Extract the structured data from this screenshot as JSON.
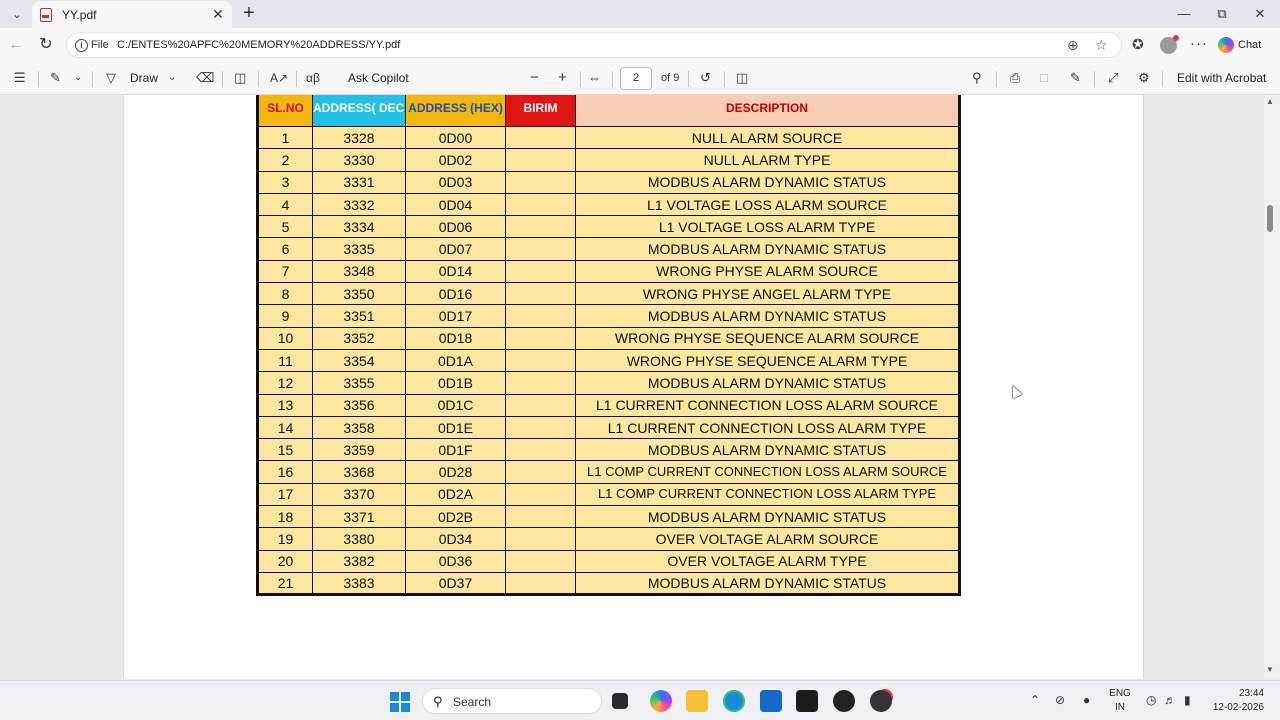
{
  "browser": {
    "tab_title": "YY.pdf",
    "url_scheme": "File",
    "url": "C:/ENTES%20APFC%20MEMORY%20ADDRESS/YY.pdf",
    "chat_label": "Chat",
    "accent_color": "#c4302b"
  },
  "pdf_toolbar": {
    "draw_label": "Draw",
    "ask_copilot_label": "Ask Copilot",
    "page_current": "2",
    "page_total": "of 9",
    "edit_acrobat_label": "Edit with Acrobat"
  },
  "table": {
    "headers": [
      "SL.NO",
      "ADDRESS( DEC)",
      "ADDRESS (HEX)",
      "BIRIM",
      "DESCRIPTION"
    ],
    "rows": [
      [
        "1",
        "3328",
        "0D00",
        "",
        "NULL ALARM SOURCE"
      ],
      [
        "2",
        "3330",
        "0D02",
        "",
        "NULL ALARM TYPE"
      ],
      [
        "3",
        "3331",
        "0D03",
        "",
        "MODBUS ALARM DYNAMIC STATUS"
      ],
      [
        "4",
        "3332",
        "0D04",
        "",
        "L1 VOLTAGE LOSS ALARM SOURCE"
      ],
      [
        "5",
        "3334",
        "0D06",
        "",
        "L1 VOLTAGE LOSS ALARM TYPE"
      ],
      [
        "6",
        "3335",
        "0D07",
        "",
        "MODBUS ALARM DYNAMIC STATUS"
      ],
      [
        "7",
        "3348",
        "0D14",
        "",
        "WRONG PHYSE ALARM SOURCE"
      ],
      [
        "8",
        "3350",
        "0D16",
        "",
        "WRONG PHYSE ANGEL ALARM TYPE"
      ],
      [
        "9",
        "3351",
        "0D17",
        "",
        "MODBUS ALARM DYNAMIC STATUS"
      ],
      [
        "10",
        "3352",
        "0D18",
        "",
        "WRONG PHYSE  SEQUENCE ALARM SOURCE"
      ],
      [
        "11",
        "3354",
        "0D1A",
        "",
        "WRONG PHYSE  SEQUENCE ALARM TYPE"
      ],
      [
        "12",
        "3355",
        "0D1B",
        "",
        "MODBUS ALARM DYNAMIC STATUS"
      ],
      [
        "13",
        "3356",
        "0D1C",
        "",
        "L1 CURRENT CONNECTION LOSS ALARM SOURCE"
      ],
      [
        "14",
        "3358",
        "0D1E",
        "",
        "L1 CURRENT CONNECTION LOSS ALARM TYPE"
      ],
      [
        "15",
        "3359",
        "0D1F",
        "",
        "MODBUS ALARM DYNAMIC STATUS"
      ],
      [
        "16",
        "3368",
        "0D28",
        "",
        "L1 COMP CURRENT CONNECTION LOSS ALARM SOURCE"
      ],
      [
        "17",
        "3370",
        "0D2A",
        "",
        "L1 COMP CURRENT CONNECTION LOSS ALARM TYPE"
      ],
      [
        "18",
        "3371",
        "0D2B",
        "",
        "MODBUS ALARM DYNAMIC STATUS"
      ],
      [
        "19",
        "3380",
        "0D34",
        "",
        "OVER VOLTAGE ALARM SOURCE"
      ],
      [
        "20",
        "3382",
        "0D36",
        "",
        "OVER VOLTAGE ALARM TYPE"
      ],
      [
        "21",
        "3383",
        "0D37",
        "",
        "MODBUS ALARM DYNAMIC STATUS"
      ]
    ],
    "header_colors": {
      "sl_no": "#f2b70f",
      "dec": "#22c0e6",
      "hex": "#f2b70f",
      "birim": "#e01616",
      "description": "#f8ccb5",
      "row_fill": "#fbe7a0"
    }
  },
  "taskbar": {
    "search_label": "Search",
    "lang_top": "ENG",
    "lang_bottom": "IN",
    "time": "23:44",
    "date": "12-02-2026"
  }
}
